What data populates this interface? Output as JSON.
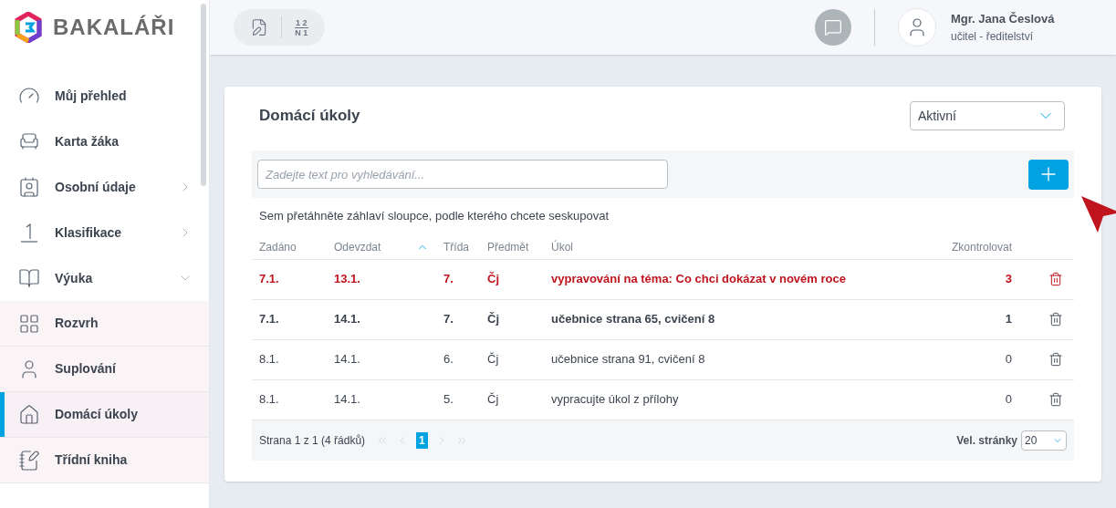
{
  "logo": {
    "text": "BAKALÁŘI"
  },
  "sidebar": {
    "items": [
      {
        "label": "Můj přehled",
        "kind": "overview",
        "selected": false
      },
      {
        "label": "Karta žáka",
        "kind": "student",
        "selected": false
      },
      {
        "label": "Osobní údaje",
        "kind": "personal",
        "selected": false,
        "expanded": false
      },
      {
        "label": "Klasifikace",
        "kind": "grades",
        "selected": false,
        "expanded": false
      },
      {
        "label": "Výuka",
        "kind": "teaching",
        "selected": false,
        "expanded": true,
        "children": [
          {
            "label": "Rozvrh",
            "kind": "timetable",
            "selected": false
          },
          {
            "label": "Suplování",
            "kind": "substitution",
            "selected": false
          },
          {
            "label": "Domácí úkoly",
            "kind": "homework",
            "selected": true
          },
          {
            "label": "Třídní kniha",
            "kind": "classbook",
            "selected": false
          }
        ]
      }
    ]
  },
  "toolbar": {
    "fraction_top": "1 2",
    "fraction_bottom": "N 1"
  },
  "user": {
    "name": "Mgr. Jana Česlová",
    "role": "učitel - ředitelství"
  },
  "panel": {
    "title": "Domácí úkoly",
    "filter": {
      "value": "Aktivní"
    },
    "search": {
      "placeholder": "Zadejte text pro vyhledávání..."
    },
    "group_hint": "Sem přetáhněte záhlaví sloupce, podle kterého chcete seskupovat",
    "table": {
      "columns": [
        {
          "label": "Zadáno",
          "sorted": false
        },
        {
          "label": "Odevzdat",
          "sorted": true
        },
        {
          "label": "Třída",
          "sorted": false
        },
        {
          "label": "Předmět",
          "sorted": false
        },
        {
          "label": "Úkol",
          "sorted": false
        },
        {
          "label": "Zkontrolovat",
          "sorted": false
        }
      ],
      "rows": [
        {
          "kind": "urgent",
          "cells": [
            "7.1.",
            "13.1.",
            "7.",
            "Čj",
            "vypravování na téma: Co chci dokázat v novém roce",
            "3"
          ]
        },
        {
          "kind": "unread",
          "cells": [
            "7.1.",
            "14.1.",
            "7.",
            "Čj",
            "učebnice strana 65, cvičení 8",
            "1"
          ]
        },
        {
          "kind": "normal",
          "cells": [
            "8.1.",
            "14.1.",
            "6.",
            "Čj",
            "učebnice strana 91, cvičení 8",
            "0"
          ]
        },
        {
          "kind": "normal",
          "cells": [
            "8.1.",
            "14.1.",
            "5.",
            "Čj",
            "vypracujte úkol z přílohy",
            "0"
          ]
        }
      ]
    },
    "pager": {
      "summary": "Strana 1 z 1 (4 řádků)",
      "pages": [
        {
          "label": "1",
          "selected": true
        }
      ],
      "size_label": "Vel. stránky",
      "size_value": "20"
    }
  }
}
